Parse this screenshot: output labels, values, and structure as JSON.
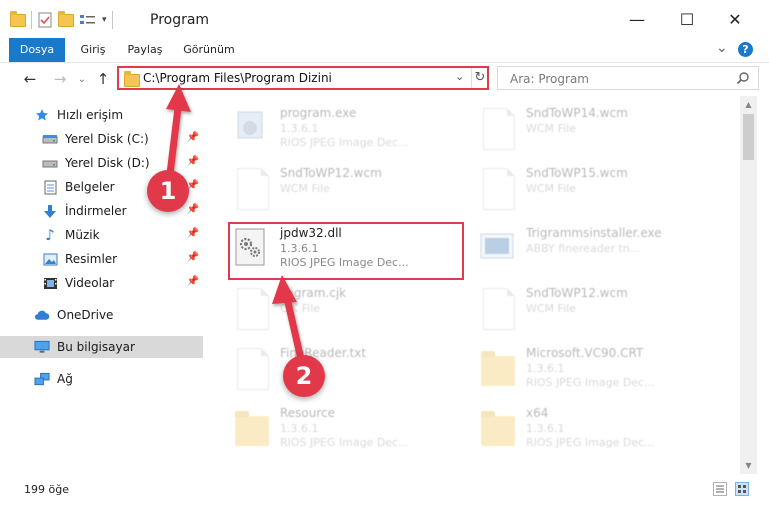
{
  "window": {
    "title": "Program",
    "minimize": "—",
    "maximize": "☐",
    "close": "✕"
  },
  "ribbon": {
    "tabs": [
      "Dosya",
      "Giriş",
      "Paylaş",
      "Görünüm"
    ],
    "collapse": "⌄",
    "help": "?"
  },
  "nav": {
    "back": "←",
    "forward": "→",
    "recent": "⌄",
    "up": "↑",
    "address": "C:\\Program Files\\Program Dizini",
    "dropdown": "⌄",
    "refresh": "↻",
    "search_placeholder": "Ara: Program"
  },
  "sidebar": {
    "items": [
      {
        "label": "Hızlı erişim",
        "icon": "star-icon",
        "pinned": false
      },
      {
        "label": "Yerel Disk (C:)",
        "icon": "drive-icon",
        "pinned": true
      },
      {
        "label": "Yerel Disk (D:)",
        "icon": "drive-icon",
        "pinned": true
      },
      {
        "label": "Belgeler",
        "icon": "documents-icon",
        "pinned": true
      },
      {
        "label": "İndirmeler",
        "icon": "download-icon",
        "pinned": true
      },
      {
        "label": "Müzik",
        "icon": "music-icon",
        "pinned": true
      },
      {
        "label": "Resimler",
        "icon": "pictures-icon",
        "pinned": true
      },
      {
        "label": "Videolar",
        "icon": "videos-icon",
        "pinned": true
      },
      {
        "label": "OneDrive",
        "icon": "cloud-icon",
        "pinned": false
      },
      {
        "label": "Bu bilgisayar",
        "icon": "computer-icon",
        "pinned": false
      },
      {
        "label": "Ağ",
        "icon": "network-icon",
        "pinned": false
      }
    ]
  },
  "files": [
    {
      "name": "program.exe",
      "sub1": "1.3.6.1",
      "sub2": "RIOS JPEG Image Dec...",
      "icon": "exe-icon"
    },
    {
      "name": "SndToWP14.wcm",
      "sub1": "WCM File",
      "sub2": "",
      "icon": "doc-icon"
    },
    {
      "name": "SndToWP12.wcm",
      "sub1": "WCM File",
      "sub2": "",
      "icon": "doc-icon"
    },
    {
      "name": "SndToWP15.wcm",
      "sub1": "WCM File",
      "sub2": "",
      "icon": "doc-icon"
    },
    {
      "name": "jpdw32.dll",
      "sub1": "1.3.6.1",
      "sub2": "RIOS JPEG Image Dec...",
      "icon": "dll-icon"
    },
    {
      "name": "Trigrammsinstaller.exe",
      "sub1": "ABBY finereader tn...",
      "sub2": "",
      "icon": "installer-icon"
    },
    {
      "name": "Trigram.cjk",
      "sub1": "CJK File",
      "sub2": "",
      "icon": "doc-icon"
    },
    {
      "name": "SndToWP12.wcm",
      "sub1": "WCM File",
      "sub2": "",
      "icon": "doc-icon"
    },
    {
      "name": "FineReader.txt",
      "sub1": "",
      "sub2": "",
      "icon": "doc-icon"
    },
    {
      "name": "Microsoft.VC90.CRT",
      "sub1": "1.3.6.1",
      "sub2": "RIOS JPEG Image Dec...",
      "icon": "folder-icon"
    },
    {
      "name": "Resource",
      "sub1": "1.3.6.1",
      "sub2": "RIOS JPEG Image Dec...",
      "icon": "folder-icon"
    },
    {
      "name": "x64",
      "sub1": "1.3.6.1",
      "sub2": "RIOS JPEG Image Dec...",
      "icon": "folder-icon"
    }
  ],
  "status": {
    "count": "199 öğe"
  },
  "annotations": {
    "step1": "1",
    "step2": "2"
  },
  "colors": {
    "accent": "#1979ca",
    "annotation": "#e2394a"
  }
}
